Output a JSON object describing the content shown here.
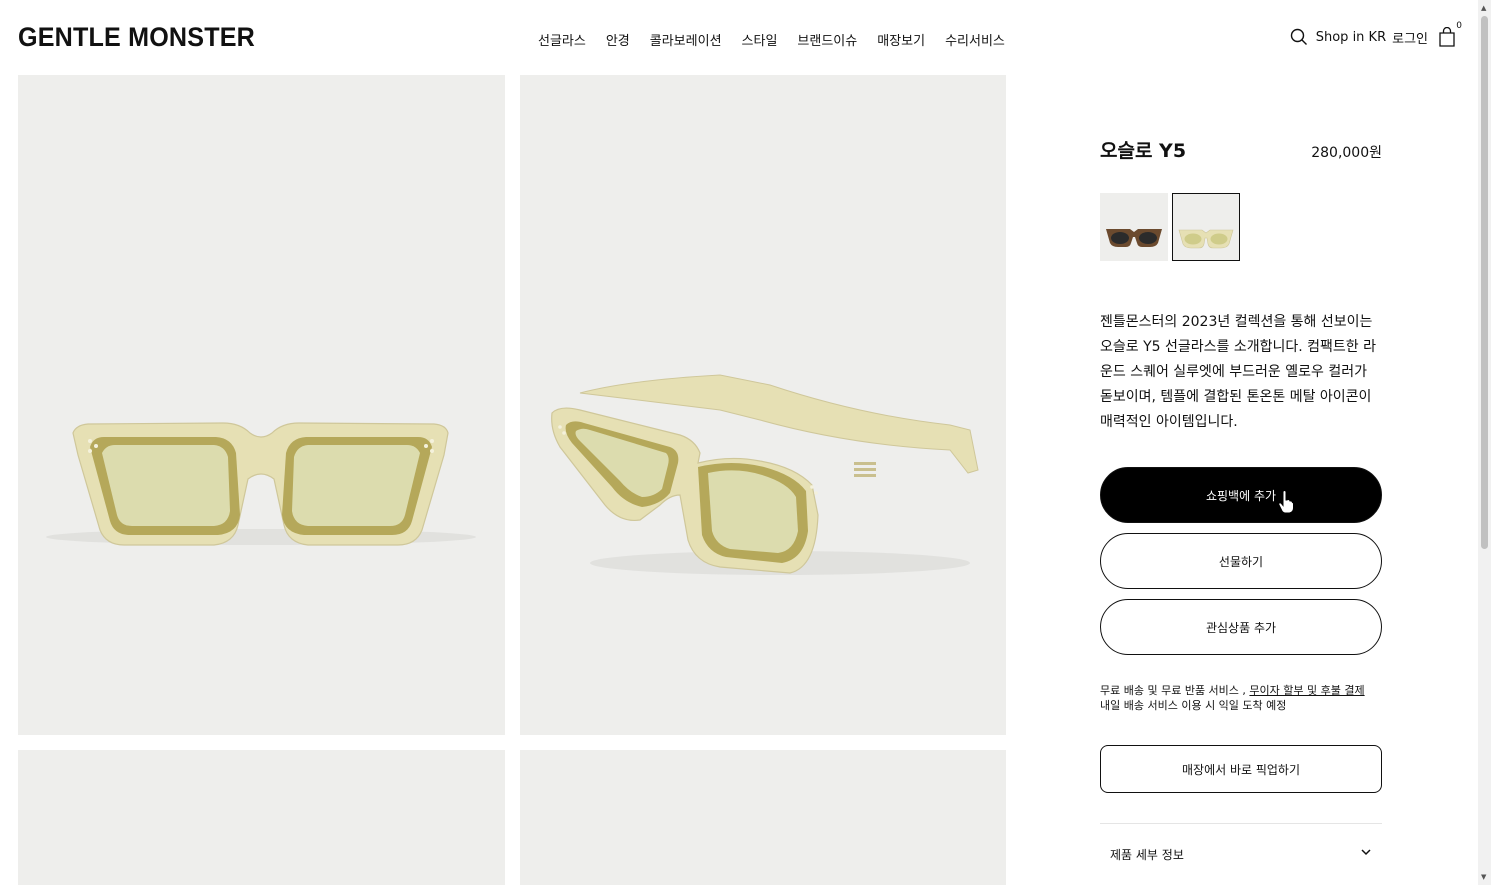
{
  "header": {
    "logo": "GENTLE MONSTER",
    "nav": [
      "선글라스",
      "안경",
      "콜라보레이션",
      "스타일",
      "브랜드이슈",
      "매장보기",
      "수리서비스"
    ],
    "shop_region": "Shop in KR",
    "login": "로그인",
    "cart_count": "0"
  },
  "product": {
    "name": "오슬로 Y5",
    "price": "280,000원",
    "swatches": [
      {
        "name": "black tortoise",
        "selected": false
      },
      {
        "name": "yellow",
        "selected": true
      }
    ],
    "description": "젠틀몬스터의 2023년 컬렉션을 통해 선보이는 오슬로 Y5 선글라스를 소개합니다. 컴팩트한 라운드 스퀘어 실루엣에 부드러운 옐로우 컬러가 돋보이며, 템플에 결합된 톤온톤 메탈 아이콘이 매력적인 아이템입니다.",
    "buttons": {
      "add_to_bag": "쇼핑백에 추가",
      "gift": "선물하기",
      "wishlist": "관심상품 추가",
      "pickup": "매장에서 바로 픽업하기"
    },
    "shipping": {
      "line1_prefix": "무료 배송 및 무료 반품 서비스 , ",
      "line1_link": "무이자 할부 및 후불 결제",
      "line2": "내일 배송 서비스 이용 시 익일 도착 예정"
    },
    "details_label": "제품 세부 정보"
  },
  "icons": {
    "search": "search-icon",
    "bag": "shopping-bag-icon",
    "chevron": "chevron-down-icon"
  },
  "colors": {
    "accent": "#000000",
    "image_background": "#eeeeec",
    "frame_yellow": "#e6e0b4"
  }
}
